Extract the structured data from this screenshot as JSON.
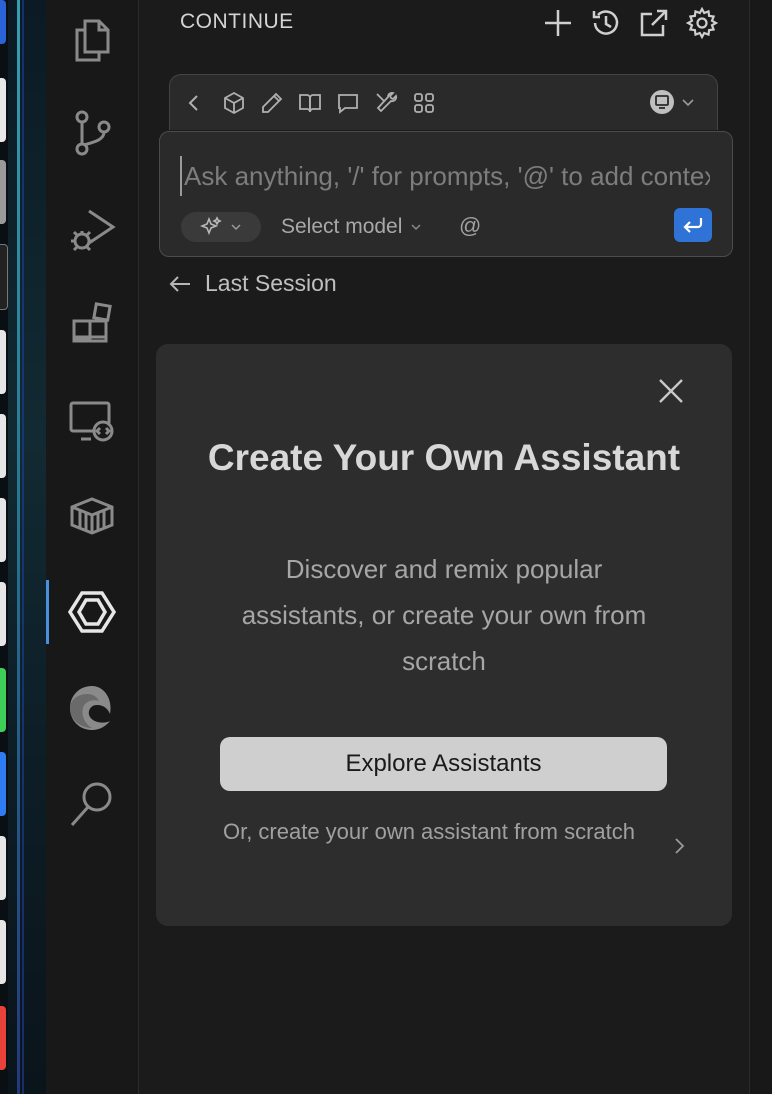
{
  "sidebar": {
    "title": "CONTINUE"
  },
  "toolbar": {
    "mode_icon": "monitor-icon"
  },
  "chat": {
    "placeholder": "Ask anything, '/' for prompts, '@' to add context",
    "model_label": "Select model",
    "at_symbol": "@"
  },
  "nav": {
    "last_session_label": "Last Session"
  },
  "card": {
    "title": "Create Your Own Assistant",
    "description": "Discover and remix popular assistants, or create your own from scratch",
    "explore_label": "Explore Assistants",
    "scratch_label": "Or, create your own assistant from scratch"
  },
  "colors": {
    "accent": "#2f73d6",
    "activity_indicator": "#4a8fe0",
    "card_bg": "#2d2d2d",
    "panel_bg": "#1b1b1b"
  }
}
